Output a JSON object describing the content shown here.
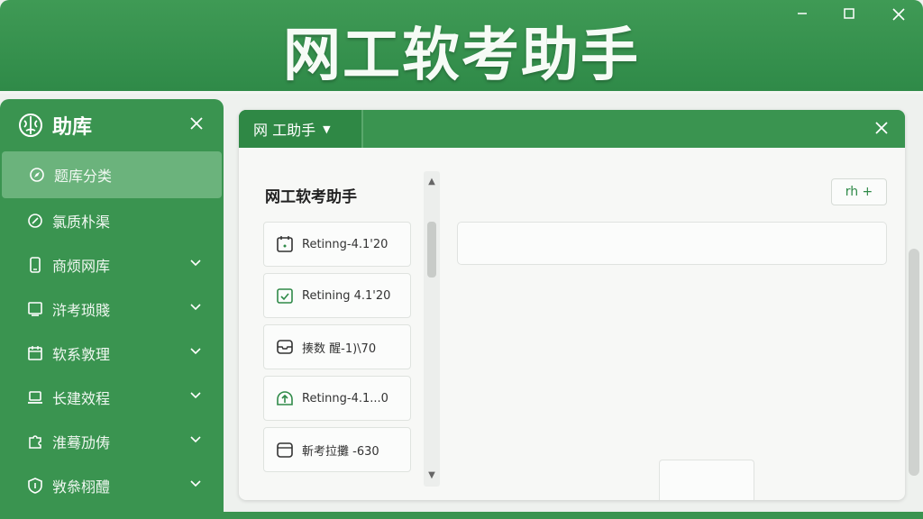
{
  "window": {
    "title": "网工软考助手",
    "minimize_icon": "minimize-icon",
    "maximize_icon": "maximize-icon",
    "close_icon": "close-icon"
  },
  "sidebar": {
    "title": "助库",
    "logo_icon": "brain-icon",
    "items": [
      {
        "label": "题库分类",
        "icon": "compass-icon",
        "active": true,
        "has_chevron": false
      },
      {
        "label": "氯质朴渠",
        "icon": "compass-icon",
        "active": false,
        "has_chevron": false
      },
      {
        "label": "商烦网库",
        "icon": "phone-icon",
        "active": false,
        "has_chevron": true
      },
      {
        "label": "浒考琐賤",
        "icon": "monitor-icon",
        "active": false,
        "has_chevron": true
      },
      {
        "label": "软系敦理",
        "icon": "calendar-icon",
        "active": false,
        "has_chevron": true
      },
      {
        "label": "长建效程",
        "icon": "laptop-icon",
        "active": false,
        "has_chevron": true
      },
      {
        "label": "淮蓦劢俦",
        "icon": "puzzle-icon",
        "active": false,
        "has_chevron": true
      },
      {
        "label": "敩叅栩醴",
        "icon": "shield-icon",
        "active": false,
        "has_chevron": true
      }
    ]
  },
  "panel": {
    "tab_label": "网 工助手",
    "list_title": "网工软考助手",
    "add_button_label": "rh +",
    "cards": [
      {
        "label": "Retinng-4.1'20",
        "icon": "calendar-icon"
      },
      {
        "label": "Retining 4.1'20",
        "icon": "calendar-check-icon"
      },
      {
        "label": "揍数 醒-1)\\70",
        "icon": "inbox-icon"
      },
      {
        "label": "Retinng-4.1...0",
        "icon": "upload-icon"
      },
      {
        "label": "斬考拉攤 -630",
        "icon": "folder-icon"
      }
    ]
  },
  "colors": {
    "brand_green": "#3a9450",
    "dark_green": "#2f8845",
    "active_item": "#6bb37c"
  }
}
